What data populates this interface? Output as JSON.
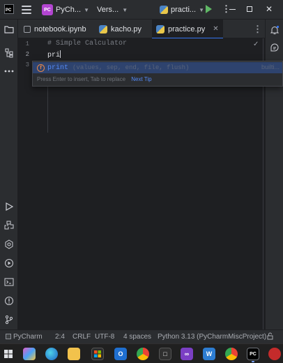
{
  "titlebar": {
    "app_logo_text": "PC",
    "project_badge": "PC",
    "project_name": "PyCh...",
    "vcs_label": "Vers...",
    "run_config": "practi..."
  },
  "tabs": [
    {
      "label": "notebook.ipynb",
      "icon": "notebook-icon",
      "active": false
    },
    {
      "label": "kacho.py",
      "icon": "python-file-icon",
      "active": false
    },
    {
      "label": "practice.py",
      "icon": "python-file-icon",
      "active": true
    }
  ],
  "editor": {
    "line_numbers": [
      "1",
      "2",
      "3"
    ],
    "line1": "# Simple Calculator",
    "line2": "pri",
    "current_line": "2"
  },
  "completion": {
    "icon_letter": "f",
    "match": "print",
    "params": "(values, sep, end, file, flush)",
    "type_hint": "builti...",
    "footer_hint": "Press Enter to insert, Tab to replace",
    "footer_link": "Next Tip"
  },
  "statusbar": {
    "project": "PyCharm",
    "position": "2:4",
    "line_sep": "CRLF",
    "encoding": "UTF-8",
    "indent": "4 spaces",
    "interpreter": "Python 3.13 (PyCharmMiscProject)"
  },
  "colors": {
    "background": "#1e1f22",
    "panel": "#2b2d30",
    "accent": "#3574f0",
    "run_green": "#5fb865",
    "badge_purple": "#b345d1"
  }
}
